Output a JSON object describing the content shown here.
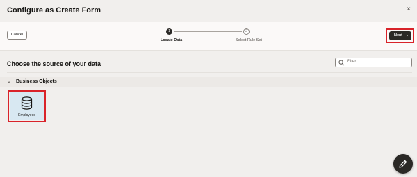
{
  "dialog": {
    "title": "Configure as Create Form",
    "close_glyph": "×"
  },
  "toolbar": {
    "cancel_label": "Cancel",
    "next_label": "Next",
    "next_chevron": "›"
  },
  "train": {
    "steps": [
      {
        "number": "1",
        "label": "Locate Data",
        "state": "current"
      },
      {
        "number": "2",
        "label": "Select Rule Set",
        "state": "upcoming"
      }
    ]
  },
  "main": {
    "section_title": "Choose the source of your data",
    "filter_placeholder": "Filter",
    "group": {
      "chevron": "⌄",
      "label": "Business Objects",
      "expanded": true
    },
    "cards": [
      {
        "label": "Employees",
        "icon": "database-icon",
        "selected": true
      }
    ]
  },
  "colors": {
    "highlight": "#d9232a",
    "primary_button": "#2b2926",
    "card_bg": "#d8e8f2"
  }
}
